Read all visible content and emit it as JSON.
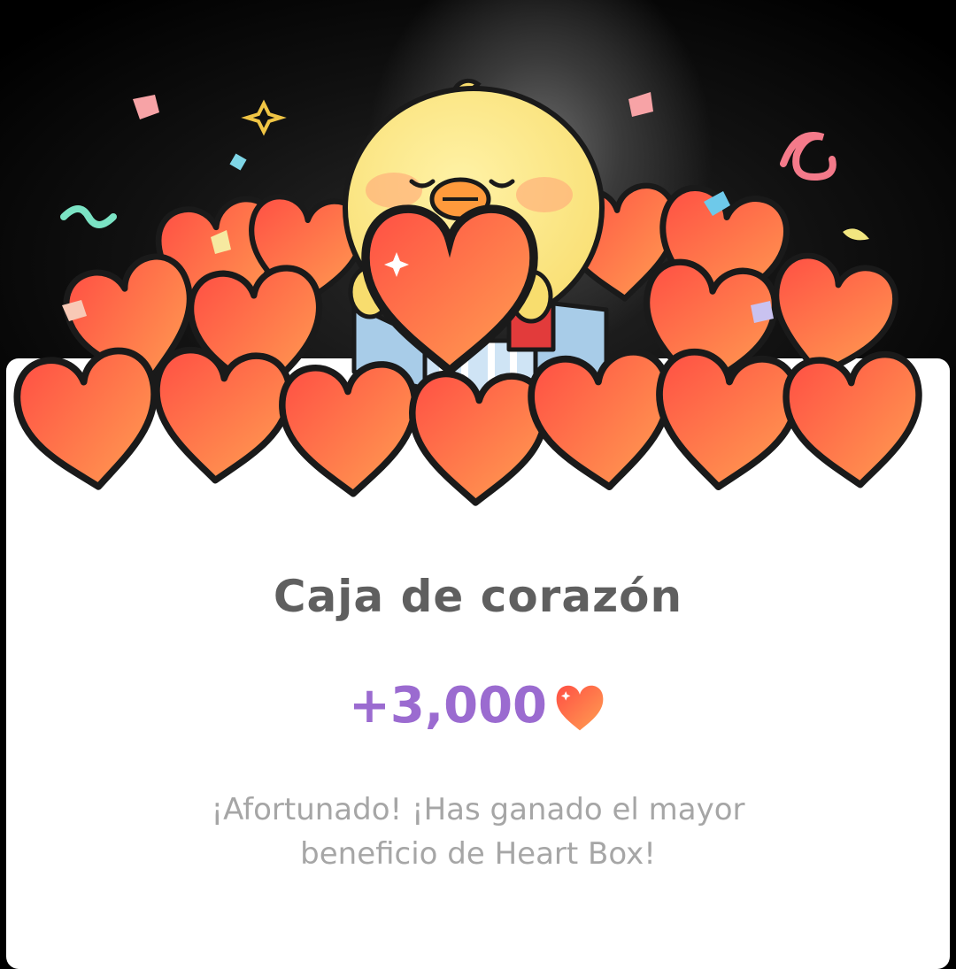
{
  "dialog": {
    "title": "Caja de corazón",
    "reward_amount": "+3,000",
    "reward_icon": "heart-icon",
    "message_line1": "¡Afortunado! ¡Has ganado el mayor",
    "message_line2": "beneficio de Heart Box!"
  },
  "colors": {
    "title": "#5f5f5f",
    "amount": "#9b6bd0",
    "message": "#a6a6a6",
    "heart_top": "#ff5a48",
    "heart_bottom": "#ff9a50"
  }
}
